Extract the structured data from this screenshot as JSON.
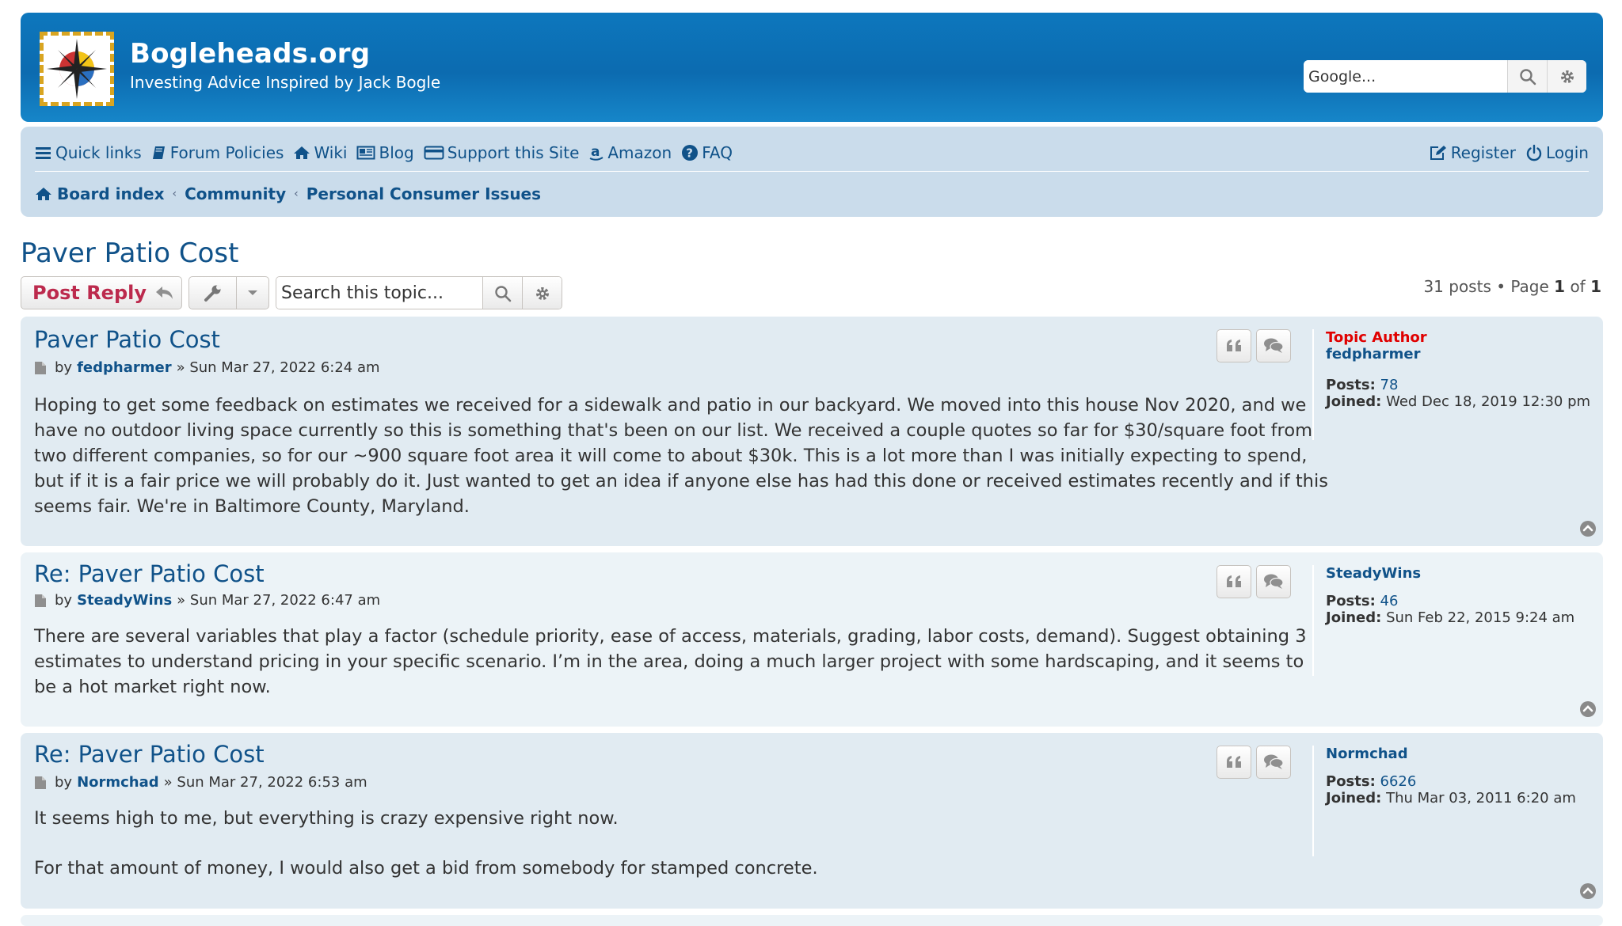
{
  "header": {
    "site_title": "Bogleheads.org",
    "site_description": "Investing Advice Inspired by Jack Bogle",
    "search_placeholder": "Google..."
  },
  "nav": {
    "left": [
      {
        "label": "Quick links",
        "icon": "bars-icon"
      },
      {
        "label": "Forum Policies",
        "icon": "book-icon"
      },
      {
        "label": "Wiki",
        "icon": "home-icon"
      },
      {
        "label": "Blog",
        "icon": "newspaper-icon"
      },
      {
        "label": "Support this Site",
        "icon": "credit-card-icon"
      },
      {
        "label": "Amazon",
        "icon": "amazon-icon"
      },
      {
        "label": "FAQ",
        "icon": "question-circle-icon"
      }
    ],
    "right": [
      {
        "label": "Register",
        "icon": "pencil-square-icon"
      },
      {
        "label": "Login",
        "icon": "power-icon"
      }
    ]
  },
  "breadcrumbs": [
    "Board index",
    "Community",
    "Personal Consumer Issues"
  ],
  "topic": {
    "title": "Paver Patio Cost",
    "post_reply_label": "Post Reply",
    "search_placeholder": "Search this topic...",
    "pagination": {
      "posts_text": "31 posts",
      "page_word": "Page",
      "current": "1",
      "of_word": "of",
      "total": "1"
    }
  },
  "posts": [
    {
      "title": "Paver Patio Cost",
      "by": "by",
      "author": "fedpharmer",
      "date": "» Sun Mar 27, 2022 6:24 am",
      "body": [
        "Hoping to get some feedback on estimates we received for a sidewalk and patio in our backyard. We moved into this house Nov 2020, and we",
        "have no outdoor living space currently so this is something that's been on our list. We received a couple quotes so far for $30/square foot from",
        "two different companies, so for our ~900 square foot area it will come to about $30k. This is a lot more than I was initially expecting to spend,",
        "but if it is a fair price we will probably do it. Just wanted to get an idea if anyone else has had this done or received estimates recently and if this",
        "seems fair. We're in Baltimore County, Maryland."
      ],
      "profile": {
        "rank": "Topic Author",
        "username": "fedpharmer",
        "posts_label": "Posts:",
        "posts": "78",
        "joined_label": "Joined:",
        "joined": "Wed Dec 18, 2019 12:30 pm"
      }
    },
    {
      "title": "Re: Paver Patio Cost",
      "by": "by",
      "author": "SteadyWins",
      "date": "» Sun Mar 27, 2022 6:47 am",
      "body": [
        "There are several variables that play a factor (schedule priority, ease of access, materials, grading, labor costs, demand). Suggest obtaining 3",
        "estimates to understand pricing in your specific scenario. I’m in the area, doing a much larger project with some hardscaping, and it seems to",
        "be a hot market right now."
      ],
      "profile": {
        "username": "SteadyWins",
        "posts_label": "Posts:",
        "posts": "46",
        "joined_label": "Joined:",
        "joined": "Sun Feb 22, 2015 9:24 am"
      }
    },
    {
      "title": "Re: Paver Patio Cost",
      "by": "by",
      "author": "Normchad",
      "date": "» Sun Mar 27, 2022 6:53 am",
      "body": [
        "It seems high to me, but everything is crazy expensive right now.",
        "For that amount of money, I would also get a bid from somebody for stamped concrete."
      ],
      "profile": {
        "username": "Normchad",
        "posts_label": "Posts:",
        "posts": "6626",
        "joined_label": "Joined:",
        "joined": "Thu Mar 03, 2011 6:20 am"
      }
    }
  ],
  "colors": {
    "header_blue": "#0c6bb0",
    "navbar_bg": "#cadceb",
    "link_blue": "#105289",
    "reply_red": "#bc2a4d",
    "topic_author_red": "#e00000",
    "post_bg_dark": "#e1ebf2",
    "post_bg_light": "#ecf3f7"
  }
}
